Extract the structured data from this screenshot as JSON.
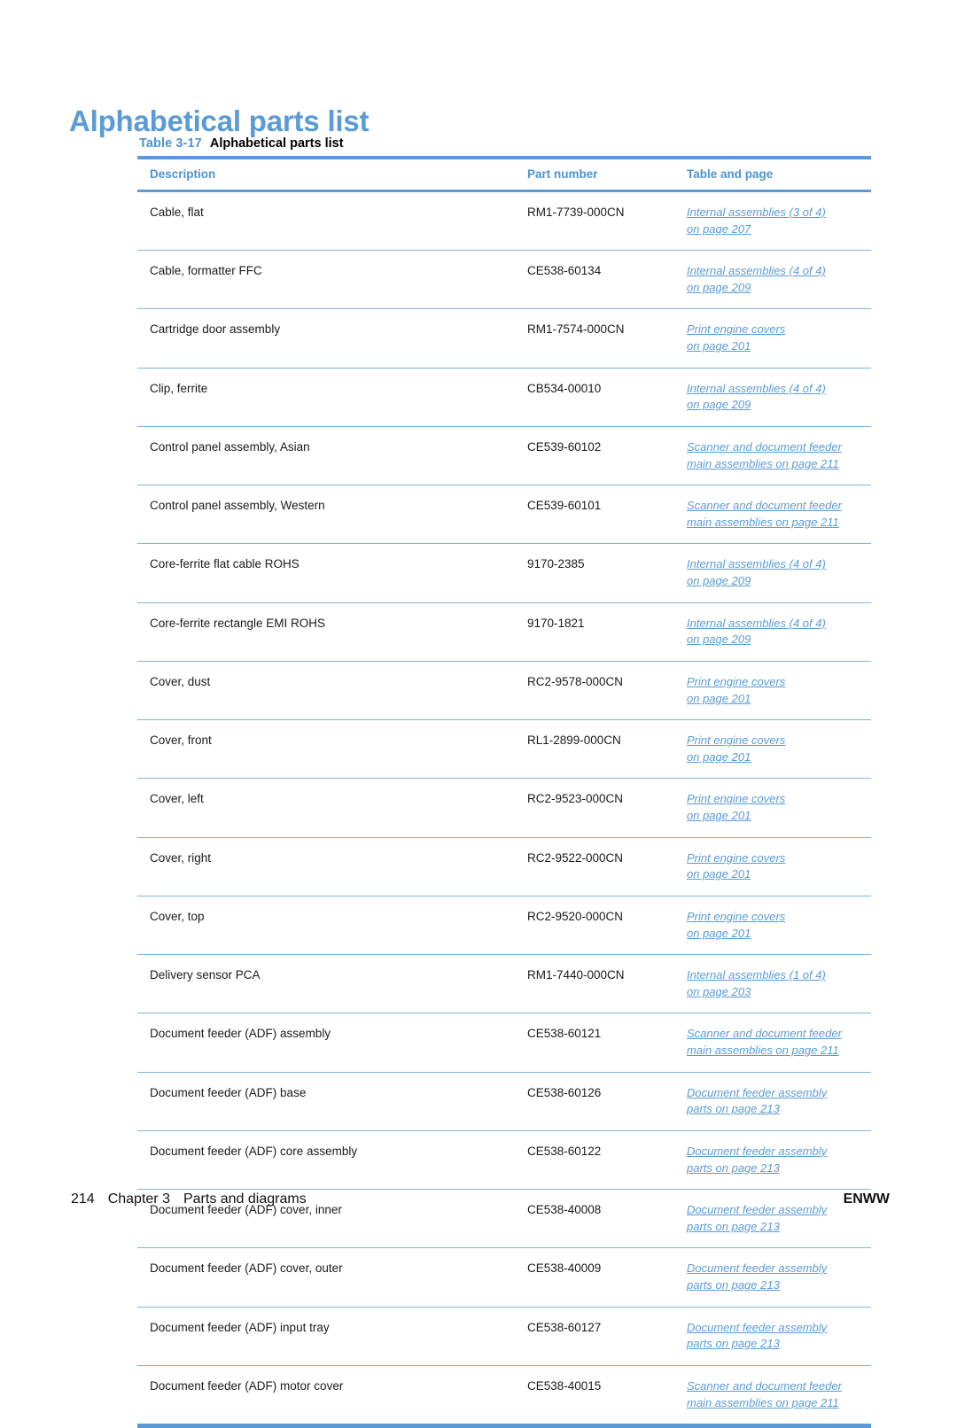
{
  "page": {
    "title": "Alphabetical parts list"
  },
  "table_caption": {
    "number": "Table 3-17",
    "text": "Alphabetical parts list"
  },
  "table": {
    "columns": [
      "Description",
      "Part number",
      "Table and page"
    ],
    "rows": [
      {
        "description": "Cable, flat",
        "part_number": "RM1-7739-000CN",
        "link_line1": "Internal assemblies (3 of 4)",
        "link_line2": "on page 207"
      },
      {
        "description": "Cable, formatter FFC",
        "part_number": "CE538-60134",
        "link_line1": "Internal assemblies (4 of 4)",
        "link_line2": "on page 209"
      },
      {
        "description": "Cartridge door assembly",
        "part_number": "RM1-7574-000CN",
        "link_line1": "Print engine covers",
        "link_line2": "on page 201"
      },
      {
        "description": "Clip, ferrite",
        "part_number": "CB534-00010",
        "link_line1": "Internal assemblies (4 of 4)",
        "link_line2": "on page 209"
      },
      {
        "description": "Control panel assembly, Asian",
        "part_number": "CE539-60102",
        "link_line1": "Scanner and document feeder",
        "link_line2": "main assemblies on page 211"
      },
      {
        "description": "Control panel assembly, Western",
        "part_number": "CE539-60101",
        "link_line1": "Scanner and document feeder",
        "link_line2": "main assemblies on page 211"
      },
      {
        "description": "Core-ferrite flat cable ROHS",
        "part_number": "9170-2385",
        "link_line1": "Internal assemblies (4 of 4)",
        "link_line2": "on page 209"
      },
      {
        "description": "Core-ferrite rectangle EMI ROHS",
        "part_number": "9170-1821",
        "link_line1": "Internal assemblies (4 of 4)",
        "link_line2": "on page 209"
      },
      {
        "description": "Cover, dust",
        "part_number": "RC2-9578-000CN",
        "link_line1": "Print engine covers",
        "link_line2": "on page 201"
      },
      {
        "description": "Cover, front",
        "part_number": "RL1-2899-000CN",
        "link_line1": "Print engine covers",
        "link_line2": "on page 201"
      },
      {
        "description": "Cover, left",
        "part_number": "RC2-9523-000CN",
        "link_line1": "Print engine covers",
        "link_line2": "on page 201"
      },
      {
        "description": "Cover, right",
        "part_number": "RC2-9522-000CN",
        "link_line1": "Print engine covers",
        "link_line2": "on page 201"
      },
      {
        "description": "Cover, top",
        "part_number": "RC2-9520-000CN",
        "link_line1": "Print engine covers",
        "link_line2": "on page 201"
      },
      {
        "description": "Delivery sensor PCA",
        "part_number": "RM1-7440-000CN",
        "link_line1": "Internal assemblies (1 of 4)",
        "link_line2": "on page 203"
      },
      {
        "description": "Document feeder (ADF) assembly",
        "part_number": "CE538-60121",
        "link_line1": "Scanner and document feeder",
        "link_line2": "main assemblies on page 211"
      },
      {
        "description": "Document feeder (ADF) base",
        "part_number": "CE538-60126",
        "link_line1": "Document feeder assembly",
        "link_line2": "parts on page 213"
      },
      {
        "description": "Document feeder (ADF) core assembly",
        "part_number": "CE538-60122",
        "link_line1": "Document feeder assembly",
        "link_line2": "parts on page 213"
      },
      {
        "description": "Document feeder (ADF) cover, inner",
        "part_number": "CE538-40008",
        "link_line1": "Document feeder assembly",
        "link_line2": "parts on page 213"
      },
      {
        "description": "Document feeder (ADF) cover, outer",
        "part_number": "CE538-40009",
        "link_line1": "Document feeder assembly",
        "link_line2": "parts on page 213"
      },
      {
        "description": "Document feeder (ADF) input tray",
        "part_number": "CE538-60127",
        "link_line1": "Document feeder assembly",
        "link_line2": "parts on page 213"
      },
      {
        "description": "Document feeder (ADF) motor cover",
        "part_number": "CE538-40015",
        "link_line1": "Scanner and document feeder",
        "link_line2": "main assemblies on page 211"
      }
    ]
  },
  "footer": {
    "page_number": "214",
    "chapter_label": "Chapter 3",
    "chapter_title": "Parts and diagrams",
    "locale": "ENWW"
  },
  "colors": {
    "heading_blue": "#5b9bd5",
    "rule_blue": "#5b9bd5",
    "link_blue": "#5b9bd5",
    "row_rule": "#7fb3de",
    "body_text": "#1a1a1a"
  }
}
